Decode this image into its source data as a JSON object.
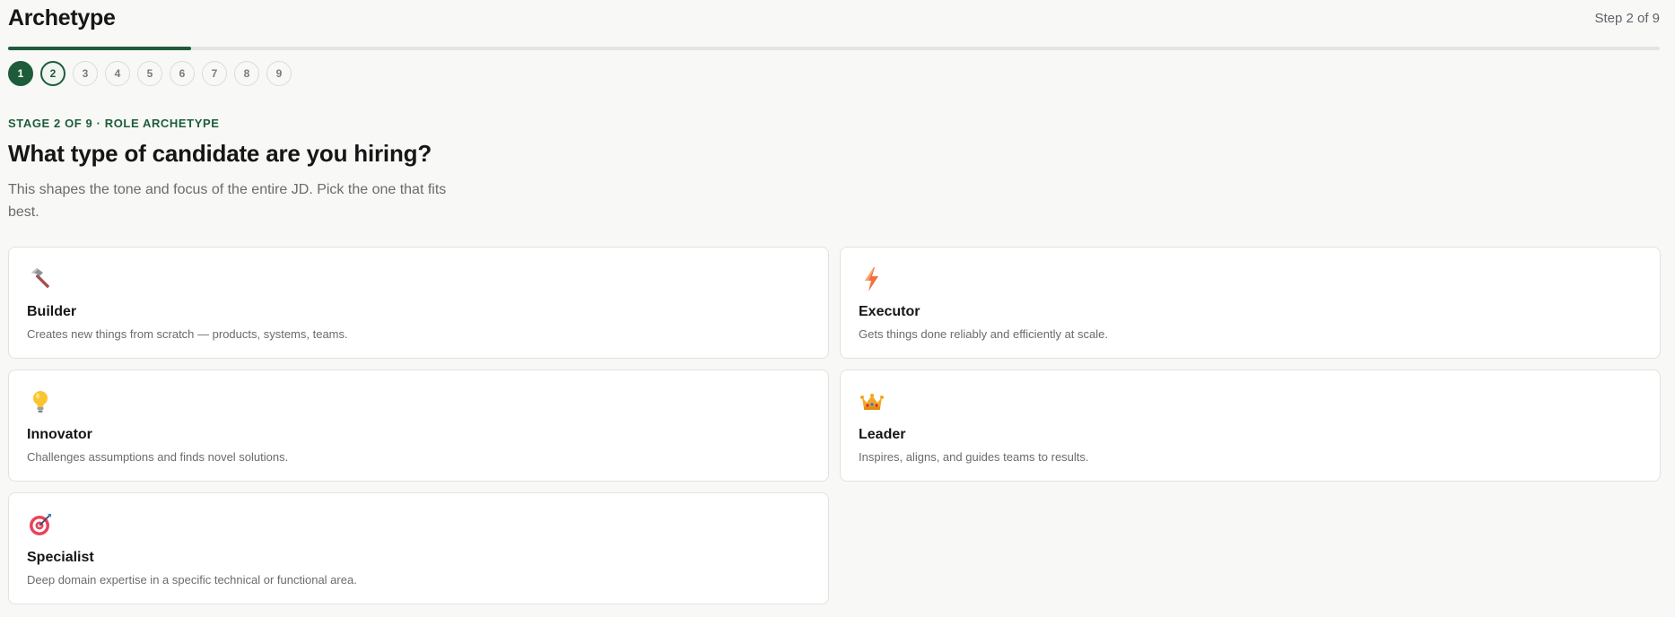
{
  "header": {
    "title": "Archetype",
    "step_indicator": "Step 2 of 9"
  },
  "progress": {
    "completed_fraction": 0.111,
    "accent_color": "#1d5c3a"
  },
  "steps": [
    {
      "label": "1",
      "state": "done"
    },
    {
      "label": "2",
      "state": "current"
    },
    {
      "label": "3",
      "state": "upcoming"
    },
    {
      "label": "4",
      "state": "upcoming"
    },
    {
      "label": "5",
      "state": "upcoming"
    },
    {
      "label": "6",
      "state": "upcoming"
    },
    {
      "label": "7",
      "state": "upcoming"
    },
    {
      "label": "8",
      "state": "upcoming"
    },
    {
      "label": "9",
      "state": "upcoming"
    }
  ],
  "stage": {
    "label": "STAGE 2 OF 9 · ROLE ARCHETYPE",
    "question": "What type of candidate are you hiring?",
    "subtitle": "This shapes the tone and focus of the entire JD. Pick the one that fits best."
  },
  "options": [
    {
      "icon": "hammer-icon",
      "title": "Builder",
      "description": "Creates new things from scratch — products, systems, teams."
    },
    {
      "icon": "lightning-icon",
      "title": "Executor",
      "description": "Gets things done reliably and efficiently at scale."
    },
    {
      "icon": "lightbulb-icon",
      "title": "Innovator",
      "description": "Challenges assumptions and finds novel solutions."
    },
    {
      "icon": "crown-icon",
      "title": "Leader",
      "description": "Inspires, aligns, and guides teams to results."
    },
    {
      "icon": "target-icon",
      "title": "Specialist",
      "description": "Deep domain expertise in a specific technical or functional area."
    }
  ]
}
